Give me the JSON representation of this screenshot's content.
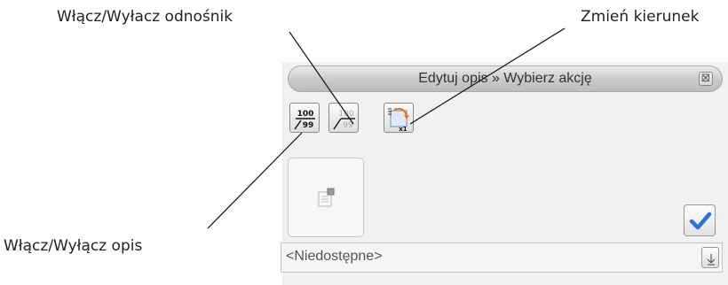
{
  "callouts": {
    "toggle_reference": "Włącz/Wyłacz odnośnik",
    "change_direction": "Zmień kierunek",
    "toggle_description": "Włącz/Wyłącz opis"
  },
  "dialog": {
    "title": "Edytuj opis » Wybierz akcję",
    "close_glyph": "⊠",
    "toolbar": {
      "description_icon_numerator": "100",
      "description_icon_denominator": "99",
      "reference_icon_numerator": "100",
      "reference_icon_denominator": "99",
      "direction_icon_label": "x1"
    },
    "combo_value": "<Niedostępne>"
  },
  "colors": {
    "check_blue": "#2a74d6",
    "arrow_orange": "#e0781c"
  }
}
